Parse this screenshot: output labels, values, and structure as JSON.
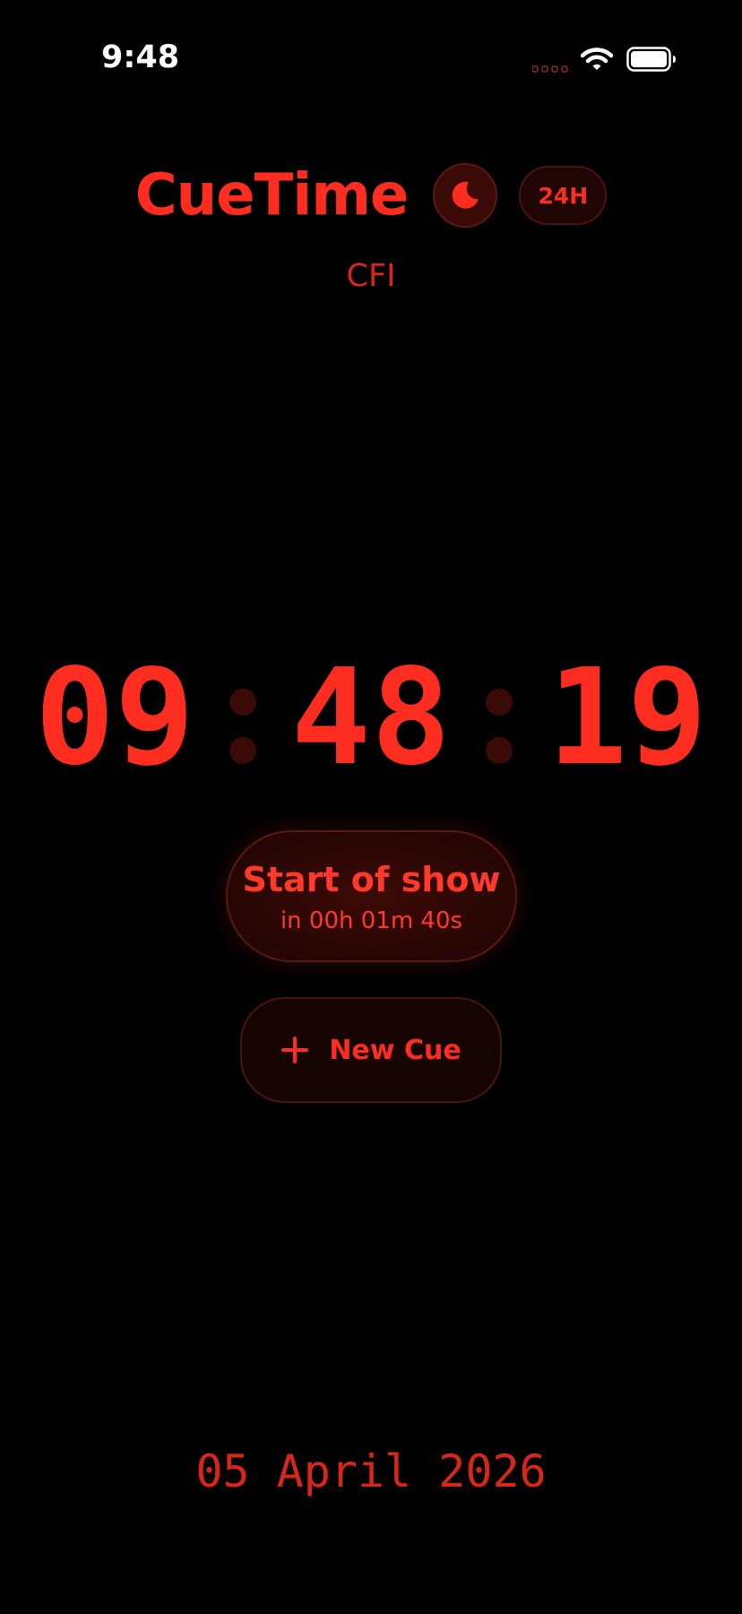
{
  "status_bar": {
    "time": "9:48"
  },
  "header": {
    "app_title": "CueTime",
    "format_label": "24H",
    "subtitle": "CFI"
  },
  "clock": {
    "hours": "09",
    "minutes": "48",
    "seconds": "19"
  },
  "next_cue": {
    "title": "Start of show",
    "countdown": "in 00h 01m 40s"
  },
  "actions": {
    "new_cue_label": "New Cue"
  },
  "date": {
    "text": "05 April 2026"
  },
  "colors": {
    "accent": "#ff2d20",
    "dim_accent": "#d8261a",
    "background": "#000000"
  },
  "icons": {
    "night_mode": "moon-icon",
    "new_cue": "plus-icon",
    "status": [
      "signal-icon",
      "wifi-icon",
      "battery-icon"
    ]
  }
}
